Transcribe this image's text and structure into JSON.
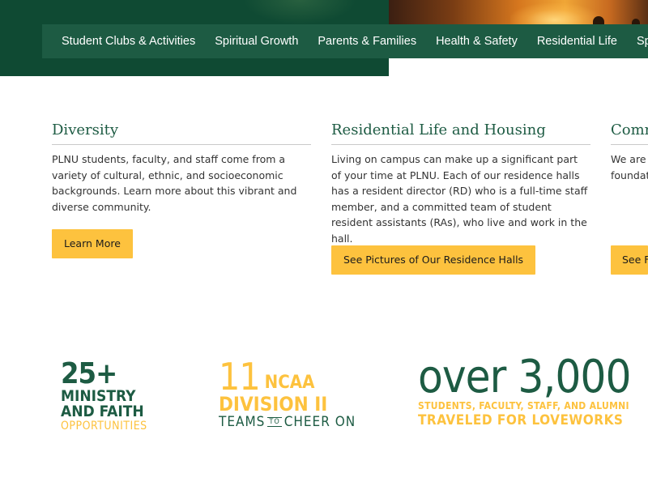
{
  "colors": {
    "brand_green": "#1d5b43",
    "dark_green": "#0f4a33",
    "accent_gold": "#fdc23e",
    "text": "#333333"
  },
  "nav": {
    "items": [
      {
        "label": "Student Clubs & Activities"
      },
      {
        "label": "Spiritual Growth"
      },
      {
        "label": "Parents & Families"
      },
      {
        "label": "Health & Safety"
      },
      {
        "label": "Residential Life"
      },
      {
        "label": "Sports & Recreation"
      }
    ]
  },
  "cards": [
    {
      "title": "Diversity",
      "body": "PLNU students, faculty, and staff come from a variety of cultural, ethnic, and socioeconomic backgrounds. Learn more about this vibrant and diverse community.",
      "button": "Learn More"
    },
    {
      "title": "Residential Life and Housing",
      "body": "Living on campus can make up a significant part of your time at PLNU. Each of our residence halls has a resident director (RD) who is a full-time staff member, and a committed team of student resident assistants (RAs), who live and work in the hall.",
      "button": "See Pictures of Our Residence Halls"
    },
    {
      "title": "Community",
      "body": "We are ... with gen... With a h... opportu... foundat...",
      "button": "See F"
    }
  ],
  "stats": {
    "ministry": {
      "number": "25+",
      "line1": "MINISTRY",
      "line2": "AND FAITH",
      "line3": "OPPORTUNITIES"
    },
    "ncaa": {
      "number": "11",
      "ncaa": "NCAA",
      "division": "DIVISION II",
      "teams": "TEAMS",
      "to": "TO",
      "cheer": "CHEER ON"
    },
    "loveworks": {
      "number": "over 3,000",
      "line1": "STUDENTS, FACULTY, STAFF, AND ALUMNI",
      "line2": "TRAVELED FOR LOVEWORKS"
    }
  }
}
